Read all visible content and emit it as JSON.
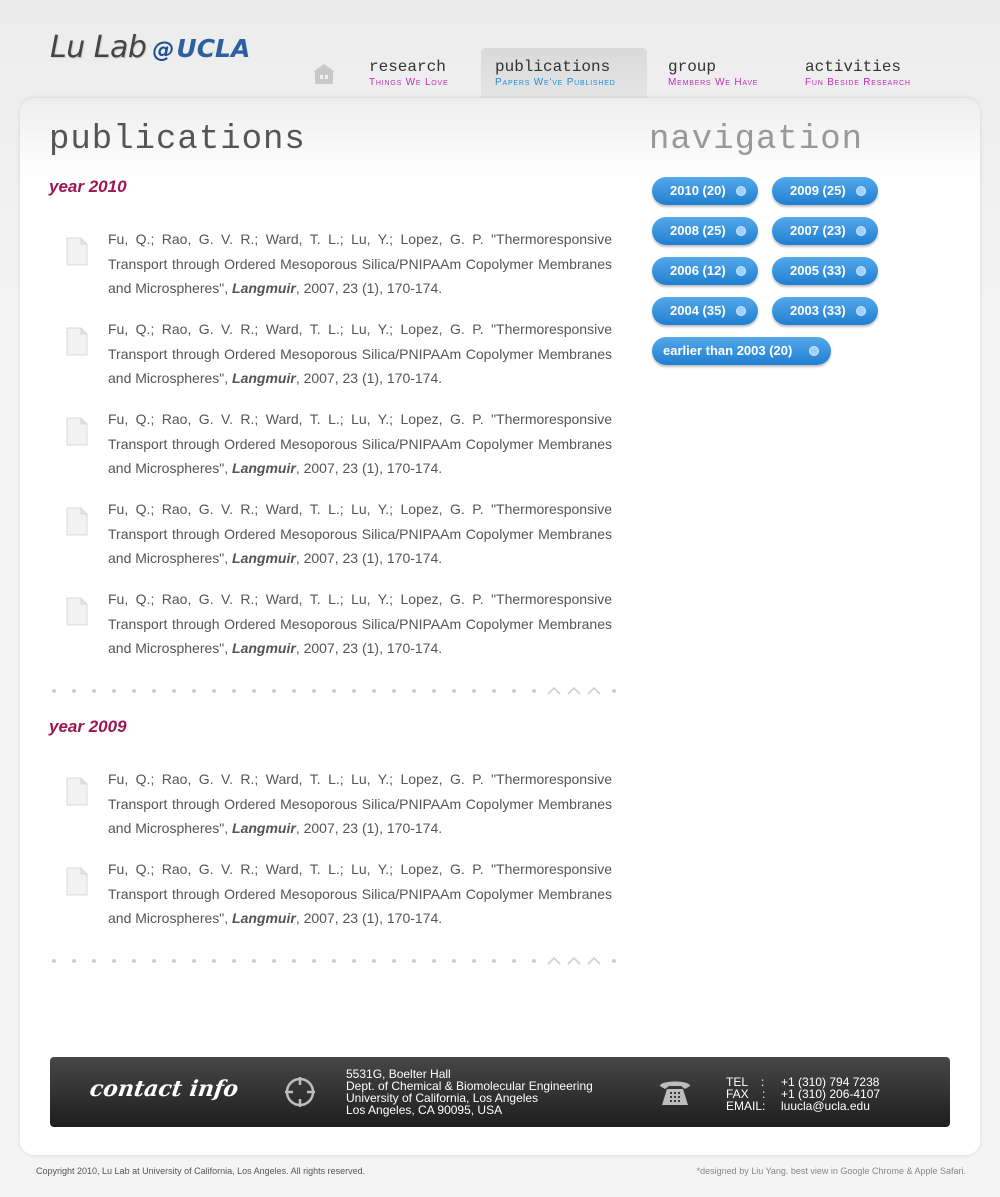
{
  "logo": {
    "name": "Lu Lab",
    "at": "@",
    "org": "UCLA"
  },
  "nav": [
    {
      "title": "research",
      "subtitle": "Things We Love"
    },
    {
      "title": "publications",
      "subtitle": "Papers We've Published"
    },
    {
      "title": "group",
      "subtitle": "Members We Have"
    },
    {
      "title": "activities",
      "subtitle": "Fun Beside Research"
    }
  ],
  "colors": {
    "subtitle": "#c22dbb",
    "active_subtitle": "#1d8fd6",
    "year": "#9c1750",
    "button": "#2a8ad8"
  },
  "main": {
    "title": "publications"
  },
  "sidebar": {
    "title": "navigation",
    "years": [
      {
        "label": "2010 (20)"
      },
      {
        "label": "2009 (25)"
      },
      {
        "label": "2008 (25)"
      },
      {
        "label": "2007 (23)"
      },
      {
        "label": "2006 (12)"
      },
      {
        "label": "2005 (33)"
      },
      {
        "label": "2004 (35)"
      },
      {
        "label": "2003 (33)"
      },
      {
        "label": "earlier than 2003 (20)"
      }
    ]
  },
  "sections": [
    {
      "year": "year 2010",
      "pubs": [
        {
          "authors": "Fu, Q.; Rao, G. V. R.; Ward, T. L.; Lu, Y.; Lopez, G. P. \"Thermoresponsive Transport through Ordered Mesoporous Silica/PNIPAAm Copolymer Membranes and Microspheres\",",
          "journal": "Langmuir",
          "details": ", 2007, 23 (1), 170-174."
        },
        {
          "authors": "Fu, Q.; Rao, G. V. R.; Ward, T. L.; Lu, Y.; Lopez, G. P. \"Thermoresponsive Transport through Ordered Mesoporous Silica/PNIPAAm Copolymer Membranes and Microspheres\",",
          "journal": "Langmuir",
          "details": ", 2007, 23 (1), 170-174."
        },
        {
          "authors": "Fu, Q.; Rao, G. V. R.; Ward, T. L.; Lu, Y.; Lopez, G. P. \"Thermoresponsive Transport through Ordered Mesoporous Silica/PNIPAAm Copolymer Membranes and Microspheres\",",
          "journal": "Langmuir",
          "details": ", 2007, 23 (1), 170-174."
        },
        {
          "authors": "Fu, Q.; Rao, G. V. R.; Ward, T. L.; Lu, Y.; Lopez, G. P. \"Thermoresponsive Transport through Ordered Mesoporous Silica/PNIPAAm Copolymer Membranes and Microspheres\",",
          "journal": "Langmuir",
          "details": ", 2007, 23 (1), 170-174."
        },
        {
          "authors": "Fu, Q.; Rao, G. V. R.; Ward, T. L.; Lu, Y.; Lopez, G. P. \"Thermoresponsive Transport through Ordered Mesoporous Silica/PNIPAAm Copolymer Membranes and Microspheres\",",
          "journal": "Langmuir",
          "details": ", 2007, 23 (1), 170-174."
        }
      ]
    },
    {
      "year": "year 2009",
      "pubs": [
        {
          "authors": "Fu, Q.; Rao, G. V. R.; Ward, T. L.; Lu, Y.; Lopez, G. P. \"Thermoresponsive Transport through Ordered Mesoporous Silica/PNIPAAm Copolymer Membranes and Microspheres\",",
          "journal": "Langmuir",
          "details": ", 2007, 23 (1), 170-174."
        },
        {
          "authors": "Fu, Q.; Rao, G. V. R.; Ward, T. L.; Lu, Y.; Lopez, G. P. \"Thermoresponsive Transport through Ordered Mesoporous Silica/PNIPAAm Copolymer Membranes and Microspheres\",",
          "journal": "Langmuir",
          "details": ", 2007, 23 (1), 170-174."
        }
      ]
    }
  ],
  "footer": {
    "title": "contact info",
    "address": [
      "5531G, Boelter Hall",
      "Dept. of Chemical & Biomolecular Engineering",
      "University of California, Los Angeles",
      "Los Angeles, CA 90095, USA"
    ],
    "contact_labels": [
      "TEL    :",
      "FAX    :",
      "EMAIL:"
    ],
    "contact_values": [
      "+1 (310) 794 7238",
      "+1 (310) 206-4107",
      "luucla@ucla.edu"
    ]
  },
  "copyright": "Copyright 2010, Lu Lab at University of California, Los Angeles. All rights reserved.",
  "designed": "*designed by Liu Yang. best view in Google Chrome & Apple Safari."
}
